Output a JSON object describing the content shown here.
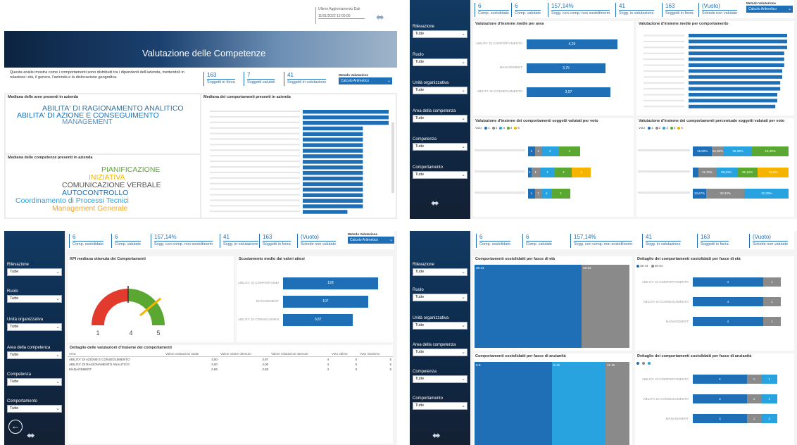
{
  "colors": {
    "accent": "#1e6fb5",
    "light_blue": "#29a3e0",
    "green": "#5aa832",
    "yellow": "#f5b400",
    "gray": "#8a8a8a",
    "red": "#e23b2e",
    "dark": "#0d2a4a"
  },
  "filters": [
    {
      "label": "Rilevazione",
      "value": "Tutte"
    },
    {
      "label": "Ruolo",
      "value": "Tutte"
    },
    {
      "label": "Unità organizzativa",
      "value": "Tutte"
    },
    {
      "label": "Area della competenza",
      "value": "Tutte"
    },
    {
      "label": "Competenza",
      "value": "Tutte"
    },
    {
      "label": "Comportamento",
      "value": "Tutte"
    }
  ],
  "kpis": [
    {
      "value": "6",
      "label": "Comp. sostolidate"
    },
    {
      "value": "6",
      "label": "Comp. valutate"
    },
    {
      "value": "157,14%",
      "label": "Sogg. con comp. non sostoltinorm"
    },
    {
      "value": "41",
      "label": "Sogg. in valutazione"
    },
    {
      "value": "163",
      "label": "Soggetti in forza"
    },
    {
      "value": "(Vuoto)",
      "label": "Schede non valutate"
    }
  ],
  "selector": {
    "title": "Metodo Valutazione",
    "value": "Calcolo Aritmetico"
  },
  "p1": {
    "update_label": "Ultimo Aggiornamento Dati",
    "update_value": "11/01/2022 12:00:00",
    "title": "Valutazione delle Competenze",
    "description": "Questa analisi mostra come i comportamenti sono distribuiti tra i dipendenti dell'azienda, mettendoli in relazione: età, il genere, l'azienda e la dislocazione geografica.",
    "kpis": [
      {
        "value": "163",
        "label": "Soggetti in forza"
      },
      {
        "value": "7",
        "label": "Soggetti valutati"
      },
      {
        "value": "41",
        "label": "Soggetti in valutazione"
      }
    ],
    "selector_title": "Metodo Valutazione",
    "selector_value": "Calcolo Aritmetico",
    "areas_title": "Mediana delle aree presenti in azienda",
    "areas_words": [
      "ABILITA' DI RAGIONAMENTO ANALITICO",
      "ABILITA' DI AZIONE E CONSEGUIMENTO",
      "MANAGEMENT"
    ],
    "comp_title": "Mediana delle competenze presenti in azienda",
    "comp_words": [
      "PIANIFICAZIONE",
      "INIZIATIVA",
      "COMUNICAZIONE VERBALE",
      "AUTOCONTROLLO",
      "Coordinamento di Processi Tecnici",
      "Management Generale"
    ],
    "behav_title": "Mediana dei comportamenti presenti in azienda"
  },
  "p2": {
    "c1_title": "Valutazione d'insieme medie per area",
    "c1_bars": [
      {
        "label": "ABILITA' DI COMPORTAMENTO",
        "value": "4,29",
        "frac": 0.92
      },
      {
        "label": "MANAGEMENT",
        "value": "3,75",
        "frac": 0.8
      },
      {
        "label": "ABILITA' DI CONSEGUIMENTO",
        "value": "3,97",
        "frac": 0.85
      }
    ],
    "c2_title": "Valutazione d'insieme medie per comportamento",
    "c3_title": "Valutazione d'insieme dei comportamenti soggetti valutati per voto",
    "c3_legend_title": "Voto",
    "c3_legend": [
      "1",
      "2",
      "3",
      "4",
      "5"
    ],
    "c4_title": "Valutazione d'insieme dei comportamenti percentuale soggetti valutati per voto",
    "c4_legend_title": "Voto",
    "c4_legend": [
      "1",
      "2",
      "3",
      "4",
      "5"
    ]
  },
  "p3": {
    "gauge_title": "KPI mediana ottenuta dei Comportamenti",
    "gauge_min": "1",
    "gauge_value": "4",
    "gauge_max": "5",
    "gauge_fraction": 0.78,
    "bars_title": "Scostamento medio dai valori attesi",
    "bars": [
      {
        "label": "ABILITA' DI COMPORTAMENTO",
        "value": "128",
        "frac": 0.95
      },
      {
        "label": "MANAGEMENT",
        "value": "107",
        "frac": 0.85
      },
      {
        "label": "ABILITA' DI CONSEGUIMENTO",
        "value": "0,87",
        "frac": 0.7
      }
    ],
    "table_title": "Dettaglio delle valutazioni d'insieme dei comportamenti",
    "table_headers": [
      "Area",
      "Valore valutazioni totale",
      "Valore valore ottenuto",
      "Valore valutazioni ottenute",
      "Voto ottimo",
      "Voto massimo"
    ],
    "table_rows": [
      [
        "ABILITA' DI AZIONE E CONSEGUIMENTO",
        "3,50",
        "3,97",
        "4",
        "5",
        "5"
      ],
      [
        "ABILITA' DI RAGIONAMENTO ANALITICO",
        "3,00",
        "4,00",
        "4",
        "5",
        "5"
      ],
      [
        "MANAGEMENT",
        "2,86",
        "3,85",
        "4",
        "5",
        "5"
      ]
    ]
  },
  "p4": {
    "t1_title": "Comportamenti sostolidatti per fasce di età",
    "t1_labels": [
      "35-44",
      "45-54"
    ],
    "t2_title": "Dettaglio dei comportamenti sostolidatti per fasce di età",
    "t2_legend": [
      "35-44",
      "45-54"
    ],
    "t2_rows": [
      {
        "label": "ABILITA' DI COMPORTAMENTO",
        "a": "4",
        "b": "1"
      },
      {
        "label": "ABILITA' DI CONSEGUIMENTO",
        "a": "4",
        "b": "1"
      },
      {
        "label": "MANAGEMENT",
        "a": "4",
        "b": "1"
      }
    ],
    "t3_title": "Comportamenti sostolidatti per fasce di anzianità",
    "t3_labels": [
      "0-5",
      "6-10",
      "11-15"
    ],
    "t4_title": "Dettaglio dei comportamenti sostolidatti per fasce di anzianità",
    "t4_rows": [
      {
        "label": "ABILITA' DI COMPORTAMENTO",
        "a": "4",
        "b": "1",
        "c": "1"
      },
      {
        "label": "ABILITA' DI CONSEGUIMENTO",
        "a": "3",
        "b": "1",
        "c": "1"
      },
      {
        "label": "MANAGEMENT",
        "a": "3",
        "b": "1",
        "c": "2"
      }
    ]
  }
}
